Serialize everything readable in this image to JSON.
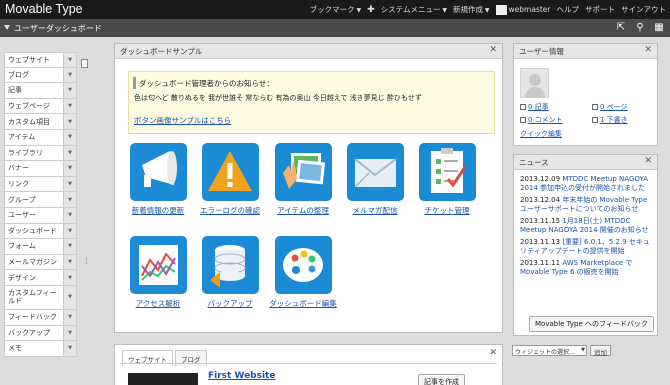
{
  "app": {
    "title": "Movable Type"
  },
  "topnav": {
    "bookmarks": "ブックマーク",
    "system_menu": "システムメニュー",
    "new_create": "新規作成",
    "user": "webmaster",
    "help": "ヘルプ",
    "support": "サポート",
    "signout": "サインアウト"
  },
  "subbar": {
    "title": "ユーザーダッシュボード"
  },
  "sidebar": {
    "items": [
      "ウェブサイト",
      "ブログ",
      "記事",
      "ウェブページ",
      "カスタム項目",
      "アイテム",
      "ライブラリ",
      "バナー",
      "リンク",
      "グループ",
      "ユーザー",
      "ダッシュボード",
      "フォーム",
      "メールマガジン",
      "デザイン",
      "カスタムフィールド",
      "フィードバック",
      "バックアップ",
      "メモ"
    ]
  },
  "dashboard_sample": {
    "title": "ダッシュボードサンプル",
    "notice_heading": "ダッシュボード管理者からのお知らせ：",
    "notice_body": "色は匂へど 散りぬるを 我が世誰そ 常ならむ 有為の奥山 今日越えて 浅き夢見じ 酔ひもせず",
    "notice_link": "ボタン画像サンプルはこちら",
    "tiles": [
      {
        "label": "新着情報の更新",
        "icon": "megaphone-icon"
      },
      {
        "label": "エラーログの確認",
        "icon": "warning-icon"
      },
      {
        "label": "アイテムの整理",
        "icon": "photo-hand-icon"
      },
      {
        "label": "メルマガ配信",
        "icon": "envelope-icon"
      },
      {
        "label": "チケット管理",
        "icon": "checklist-icon"
      },
      {
        "label": "アクセス解析",
        "icon": "line-chart-icon"
      },
      {
        "label": "バックアップ",
        "icon": "database-icon"
      },
      {
        "label": "ダッシュボード編集",
        "icon": "palette-icon"
      }
    ]
  },
  "website_panel": {
    "tabs": [
      "ウェブサイト",
      "ブログ"
    ],
    "site_name": "First Website",
    "create_entry": "記事を作成"
  },
  "user_info": {
    "title": "ユーザー情報",
    "entries": "0 記事",
    "pages": "0 ページ",
    "comments": "0 コメント",
    "drafts": "1 下書き",
    "quick_edit": "クイック編集"
  },
  "news": {
    "title": "ニュース",
    "items": [
      {
        "date": "2013.12.09",
        "text": "MTDDC Meetup NAGOYA 2014 参加申込の受付が開始されました"
      },
      {
        "date": "2013.12.04",
        "text": "年末年始の Movable Type ユーザーサポートについてのお知らせ"
      },
      {
        "date": "2013.11.15",
        "text": "1月18日(土) MTDDC Meetup NAGOYA 2014 開催のお知らせ"
      },
      {
        "date": "2013.11.13",
        "text": "[重要] 6.0.1、5.2.9 セキュリティアップデートの提供を開始"
      },
      {
        "date": "2013.11.11",
        "text": "AWS Marketplace で Movable Type 6 の販売を開始"
      }
    ],
    "feedback_button": "Movable Type へのフィードバック"
  },
  "widget_add": {
    "select_placeholder": "ウィジェットの選択...",
    "add_button": "追加"
  }
}
